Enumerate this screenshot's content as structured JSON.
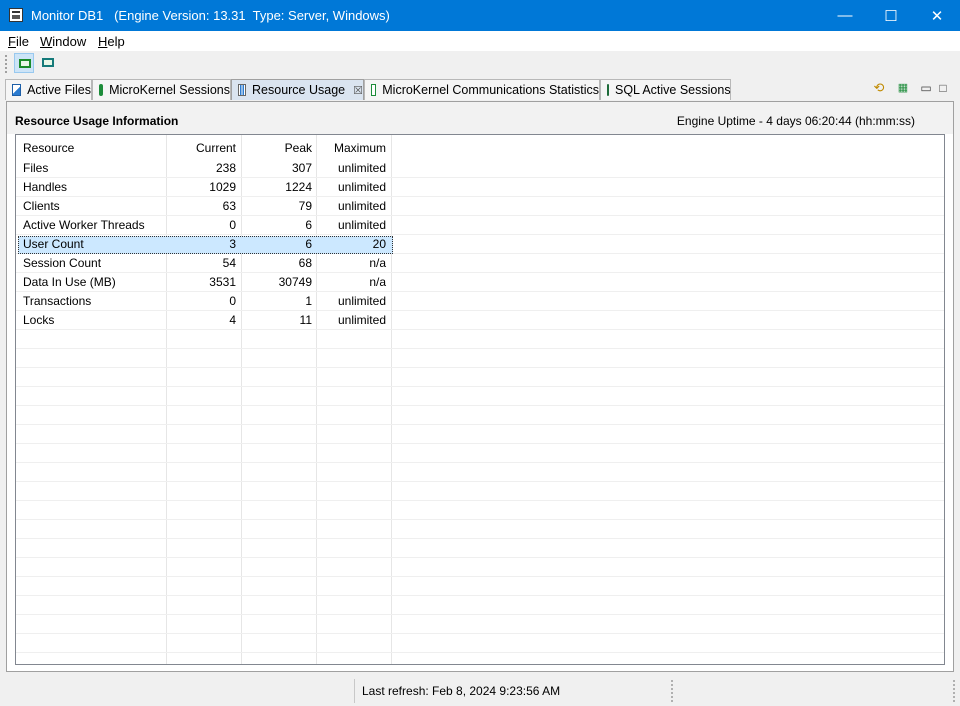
{
  "window": {
    "title": "Monitor DB1   (Engine Version: 13.31  Type: Server, Windows)",
    "minimize_glyph": "—",
    "maximize_glyph": "☐",
    "close_glyph": "✕"
  },
  "menu": [
    {
      "label": "File",
      "mnemonic": "F",
      "rest": "ile"
    },
    {
      "label": "Window",
      "mnemonic": "W",
      "rest": "indow"
    },
    {
      "label": "Help",
      "mnemonic": "H",
      "rest": "elp"
    }
  ],
  "tabs": [
    {
      "label": "Active Files",
      "icon": "active-files-icon"
    },
    {
      "label": "MicroKernel Sessions",
      "icon": "sessions-icon"
    },
    {
      "label": "Resource Usage",
      "icon": "resource-usage-icon",
      "selected": true,
      "close": "☒"
    },
    {
      "label": "MicroKernel Communications Statistics",
      "icon": "communications-icon"
    },
    {
      "label": "SQL Active Sessions",
      "icon": "sql-sessions-icon"
    }
  ],
  "tab_controls": {
    "minimize": "▭",
    "maximize": "□"
  },
  "panel": {
    "title": "Resource Usage Information",
    "uptime": "Engine Uptime - 4 days 06:20:44 (hh:mm:ss)"
  },
  "table": {
    "columns": [
      "Resource",
      "Current",
      "Peak",
      "Maximum"
    ],
    "rows": [
      [
        "Files",
        "238",
        "307",
        "unlimited"
      ],
      [
        "Handles",
        "1029",
        "1224",
        "unlimited"
      ],
      [
        "Clients",
        "63",
        "79",
        "unlimited"
      ],
      [
        "Active Worker Threads",
        "0",
        "6",
        "unlimited"
      ],
      [
        "User Count",
        "3",
        "6",
        "20"
      ],
      [
        "Session Count",
        "54",
        "68",
        "n/a"
      ],
      [
        "Data In Use (MB)",
        "3531",
        "30749",
        "n/a"
      ],
      [
        "Transactions",
        "0",
        "1",
        "unlimited"
      ],
      [
        "Locks",
        "4",
        "11",
        "unlimited"
      ]
    ],
    "selected_row": 4
  },
  "status": {
    "last_refresh": "Last refresh: Feb 8, 2024 9:23:56 AM"
  },
  "colors": {
    "titlebar": "#0078d7",
    "selection": "#cce8ff",
    "selected_tab": "#dae4f0"
  }
}
